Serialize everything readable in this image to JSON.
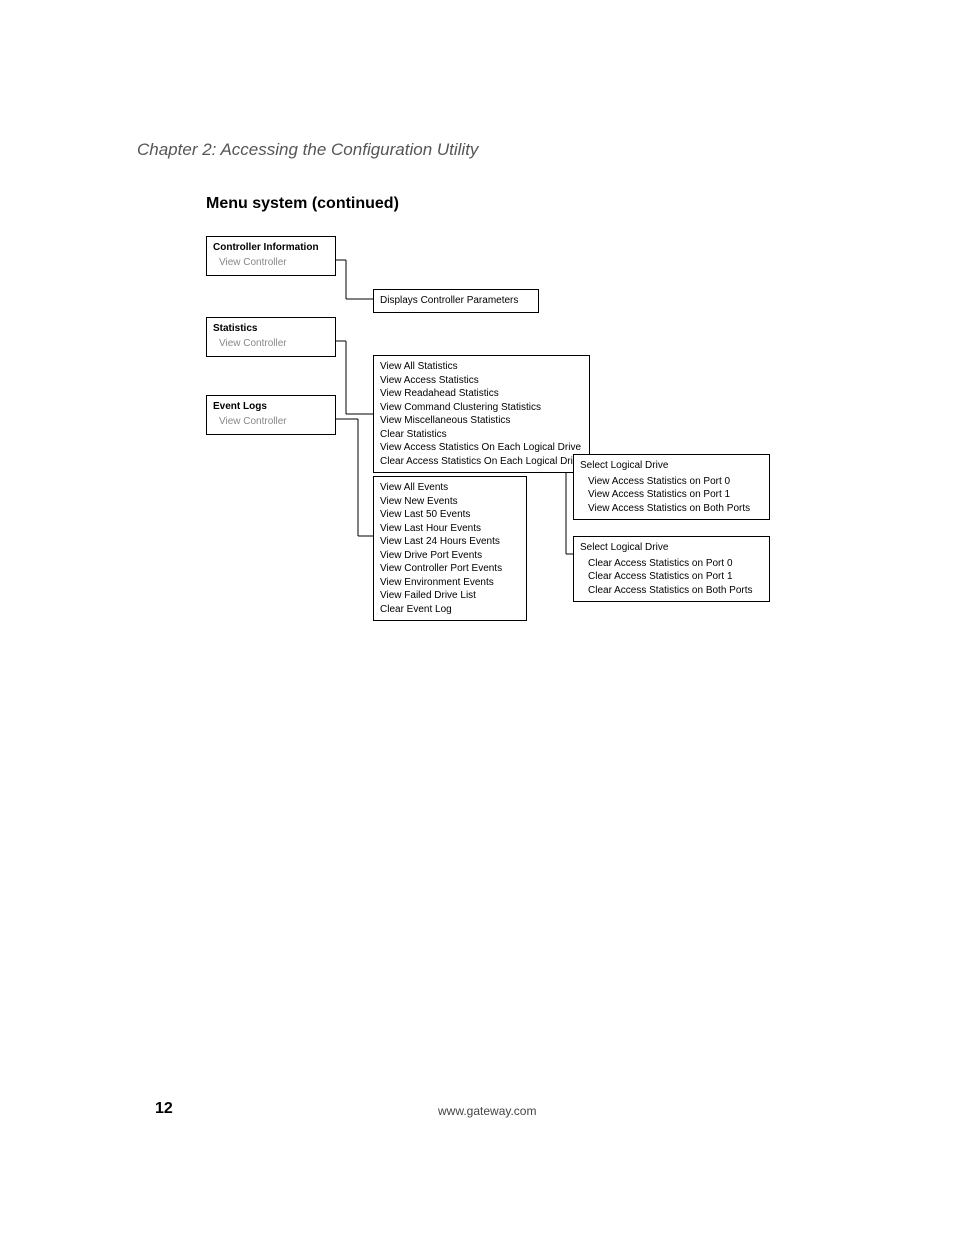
{
  "page": {
    "chapter": "Chapter 2: Accessing the Configuration Utility",
    "section": "Menu system (continued)",
    "number": "12",
    "url": "www.gateway.com"
  },
  "diagram": {
    "controller_info": {
      "title": "Controller Information",
      "item": "View Controller",
      "child": "Displays Controller Parameters"
    },
    "statistics": {
      "title": "Statistics",
      "item": "View Controller",
      "children": {
        "i0": "View All Statistics",
        "i1": "View Access Statistics",
        "i2": "View Readahead Statistics",
        "i3": "View Command Clustering Statistics",
        "i4": "View Miscellaneous Statistics",
        "i5": "Clear Statistics",
        "i6": "View Access Statistics On Each Logical Drive",
        "i7": "Clear Access Statistics On Each Logical Drive"
      },
      "view_ld": {
        "hdr": "Select Logical Drive",
        "i0": "View Access Statistics on Port 0",
        "i1": "View Access Statistics on Port 1",
        "i2": "View Access Statistics on Both Ports"
      },
      "clear_ld": {
        "hdr": "Select Logical Drive",
        "i0": "Clear Access Statistics on Port 0",
        "i1": "Clear Access Statistics on Port 1",
        "i2": "Clear Access Statistics on Both Ports"
      }
    },
    "event_logs": {
      "title": "Event Logs",
      "item": "View Controller",
      "children": {
        "i0": "View All Events",
        "i1": "View New Events",
        "i2": "View Last 50 Events",
        "i3": "View Last Hour Events",
        "i4": "View Last 24 Hours Events",
        "i5": "View Drive Port Events",
        "i6": "View Controller Port Events",
        "i7": "View Environment Events",
        "i8": "View Failed Drive List",
        "i9": "Clear Event Log"
      }
    }
  }
}
